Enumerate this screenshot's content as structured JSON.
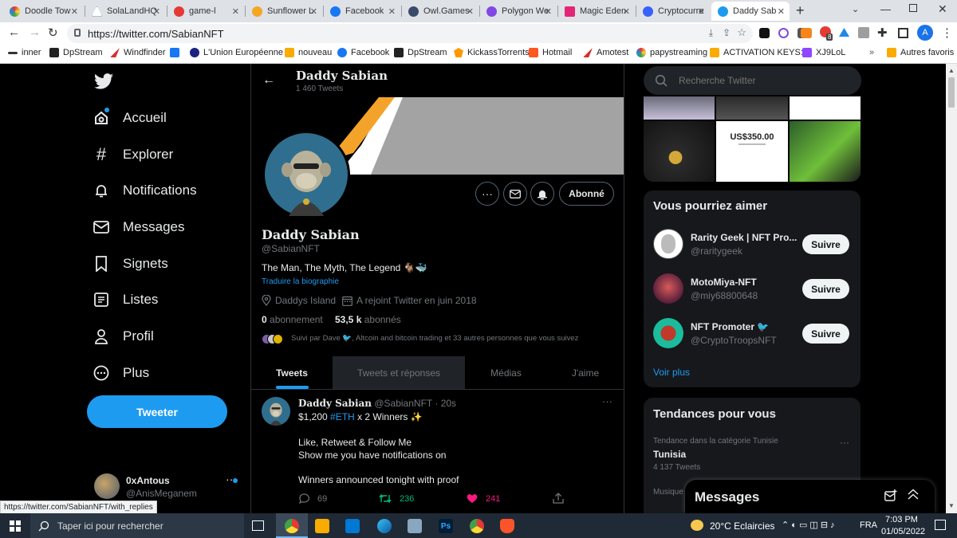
{
  "browser": {
    "tabs": [
      {
        "label": "Doodle Tow",
        "color": "#6ad0ff"
      },
      {
        "label": "SolaLandHQ",
        "color": "#ffffff"
      },
      {
        "label": "game-l",
        "color": "#e53935"
      },
      {
        "label": "Sunflower L",
        "color": "#f5a623"
      },
      {
        "label": "Facebook",
        "color": "#1877f2"
      },
      {
        "label": "Owl.Games",
        "color": "#3b4a6b"
      },
      {
        "label": "Polygon We",
        "color": "#8247e5"
      },
      {
        "label": "Magic Eden",
        "color": "#e42575"
      },
      {
        "label": "Cryptocurre",
        "color": "#3861fb"
      },
      {
        "label": "Daddy Sab",
        "color": "#1d9bf0"
      }
    ],
    "url": "https://twitter.com/SabianNFT",
    "status_url": "https://twitter.com/SabianNFT/with_replies",
    "bookmarks": [
      "inner",
      "DpStream",
      "Windfinder",
      "L'Union Européenne",
      "nouveau",
      "Facebook",
      "DpStream",
      "KickassTorrents",
      "Hotmail",
      "Amotest",
      "papystreaming",
      "ACTIVATION KEYS:...",
      "XJ9LoL"
    ],
    "other_bookmarks": "Autres favoris",
    "profile_initial": "A",
    "ext_badge": "8"
  },
  "nav": {
    "items": [
      "Accueil",
      "Explorer",
      "Notifications",
      "Messages",
      "Signets",
      "Listes",
      "Profil",
      "Plus"
    ],
    "tweet_button": "Tweeter",
    "account_name": "0xAntous",
    "account_handle": "@AnisMeganem"
  },
  "header": {
    "name": "Daddy Sabian",
    "tweet_count": "1 460 Tweets"
  },
  "profile": {
    "name": "Daddy Sabian",
    "handle": "@SabianNFT",
    "bio": "The Man, The Myth, The Legend 🐐🐳",
    "translate": "Traduire la biographie",
    "location": "Daddys Island",
    "joined": "A rejoint Twitter en juin 2018",
    "following_count": "0",
    "following_label": "abonnement",
    "followers_count": "53,5 k",
    "followers_label": "abonnés",
    "followed_by": "Suivi par Dave 🐦, Altcoin and bitcoin trading et 33 autres personnes que vous suivez",
    "following_button": "Abonné"
  },
  "tabs": [
    "Tweets",
    "Tweets et réponses",
    "Médias",
    "J'aime"
  ],
  "tweet": {
    "name": "Daddy Sabian",
    "handle": "@SabianNFT",
    "time": "· 20s",
    "line1_pre": "$1,200 ",
    "hashtag": "#ETH",
    "line1_post": " x 2 Winners ✨",
    "line2": "Like, Retweet & Follow Me",
    "line3": "Show me you have notifications on",
    "line4": "Winners announced tonight with proof",
    "replies": "69",
    "retweets": "236",
    "likes": "241"
  },
  "search": {
    "placeholder": "Recherche Twitter"
  },
  "media_preview": {
    "amount": "US$350.00"
  },
  "suggestions": {
    "title": "Vous pourriez aimer",
    "items": [
      {
        "name": "Rarity Geek | NFT Pro...",
        "handle": "@raritygeek",
        "button": "Suivre"
      },
      {
        "name": "MotoMiya-NFT",
        "handle": "@miy68800648",
        "button": "Suivre"
      },
      {
        "name": "NFT Promoter 🐦",
        "handle": "@CryptoTroopsNFT",
        "button": "Suivre"
      }
    ],
    "more": "Voir plus"
  },
  "trends": {
    "title": "Tendances pour vous",
    "context": "Tendance dans la catégorie Tunisie",
    "topic": "Tunisia",
    "count": "4 137 Tweets",
    "next_context": "Musique"
  },
  "messages_drawer": {
    "title": "Messages"
  },
  "taskbar": {
    "search": "Taper ici pour rechercher",
    "weather": "20°C Eclaircies",
    "lang": "FRA",
    "time": "7:03 PM",
    "date": "01/05/2022"
  },
  "colors": {
    "accent": "#1d9bf0",
    "like": "#f91880",
    "retweet": "#00ba7c"
  }
}
